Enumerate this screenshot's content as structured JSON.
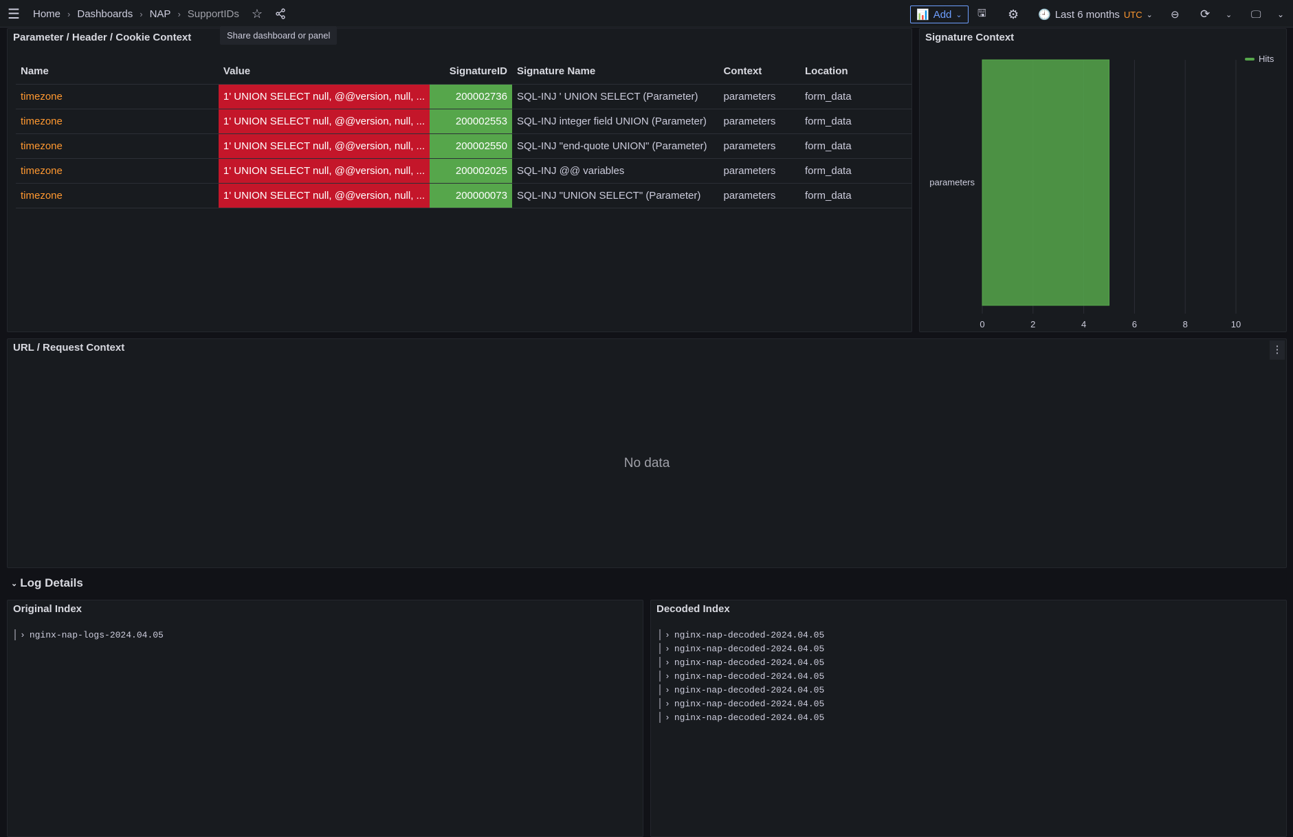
{
  "breadcrumb": [
    "Home",
    "Dashboards",
    "NAP",
    "SupportIDs"
  ],
  "tooltip": "Share dashboard or panel",
  "toolbar": {
    "add": "Add",
    "time_range": "Last 6 months",
    "timezone": "UTC"
  },
  "param_panel": {
    "title": "Parameter / Header / Cookie Context",
    "columns": [
      "Name",
      "Value",
      "SignatureID",
      "Signature Name",
      "Context",
      "Location"
    ],
    "rows": [
      [
        "timezone",
        "1' UNION SELECT null, @@version, null, ...",
        "200002736",
        "SQL-INJ ' UNION SELECT (Parameter)",
        "parameters",
        "form_data"
      ],
      [
        "timezone",
        "1' UNION SELECT null, @@version, null, ...",
        "200002553",
        "SQL-INJ integer field UNION (Parameter)",
        "parameters",
        "form_data"
      ],
      [
        "timezone",
        "1' UNION SELECT null, @@version, null, ...",
        "200002550",
        "SQL-INJ \"end-quote UNION\" (Parameter)",
        "parameters",
        "form_data"
      ],
      [
        "timezone",
        "1' UNION SELECT null, @@version, null, ...",
        "200002025",
        "SQL-INJ @@ variables",
        "parameters",
        "form_data"
      ],
      [
        "timezone",
        "1' UNION SELECT null, @@version, null, ...",
        "200000073",
        "SQL-INJ \"UNION SELECT\" (Parameter)",
        "parameters",
        "form_data"
      ]
    ]
  },
  "chart_data": {
    "type": "bar",
    "orientation": "horizontal",
    "title": "Signature Context",
    "categories": [
      "parameters"
    ],
    "series": [
      {
        "name": "Hits",
        "values": [
          5
        ],
        "color": "#56a64b"
      }
    ],
    "xlim": [
      0,
      10
    ],
    "xticks": [
      0,
      2,
      4,
      6,
      8,
      10
    ],
    "legend": "top-right"
  },
  "url_panel": {
    "title": "URL / Request Context",
    "empty": "No data"
  },
  "log_row": {
    "title": "Log Details"
  },
  "original_index": {
    "title": "Original Index",
    "items": [
      "nginx-nap-logs-2024.04.05"
    ]
  },
  "decoded_index": {
    "title": "Decoded Index",
    "items": [
      "nginx-nap-decoded-2024.04.05",
      "nginx-nap-decoded-2024.04.05",
      "nginx-nap-decoded-2024.04.05",
      "nginx-nap-decoded-2024.04.05",
      "nginx-nap-decoded-2024.04.05",
      "nginx-nap-decoded-2024.04.05",
      "nginx-nap-decoded-2024.04.05"
    ]
  }
}
